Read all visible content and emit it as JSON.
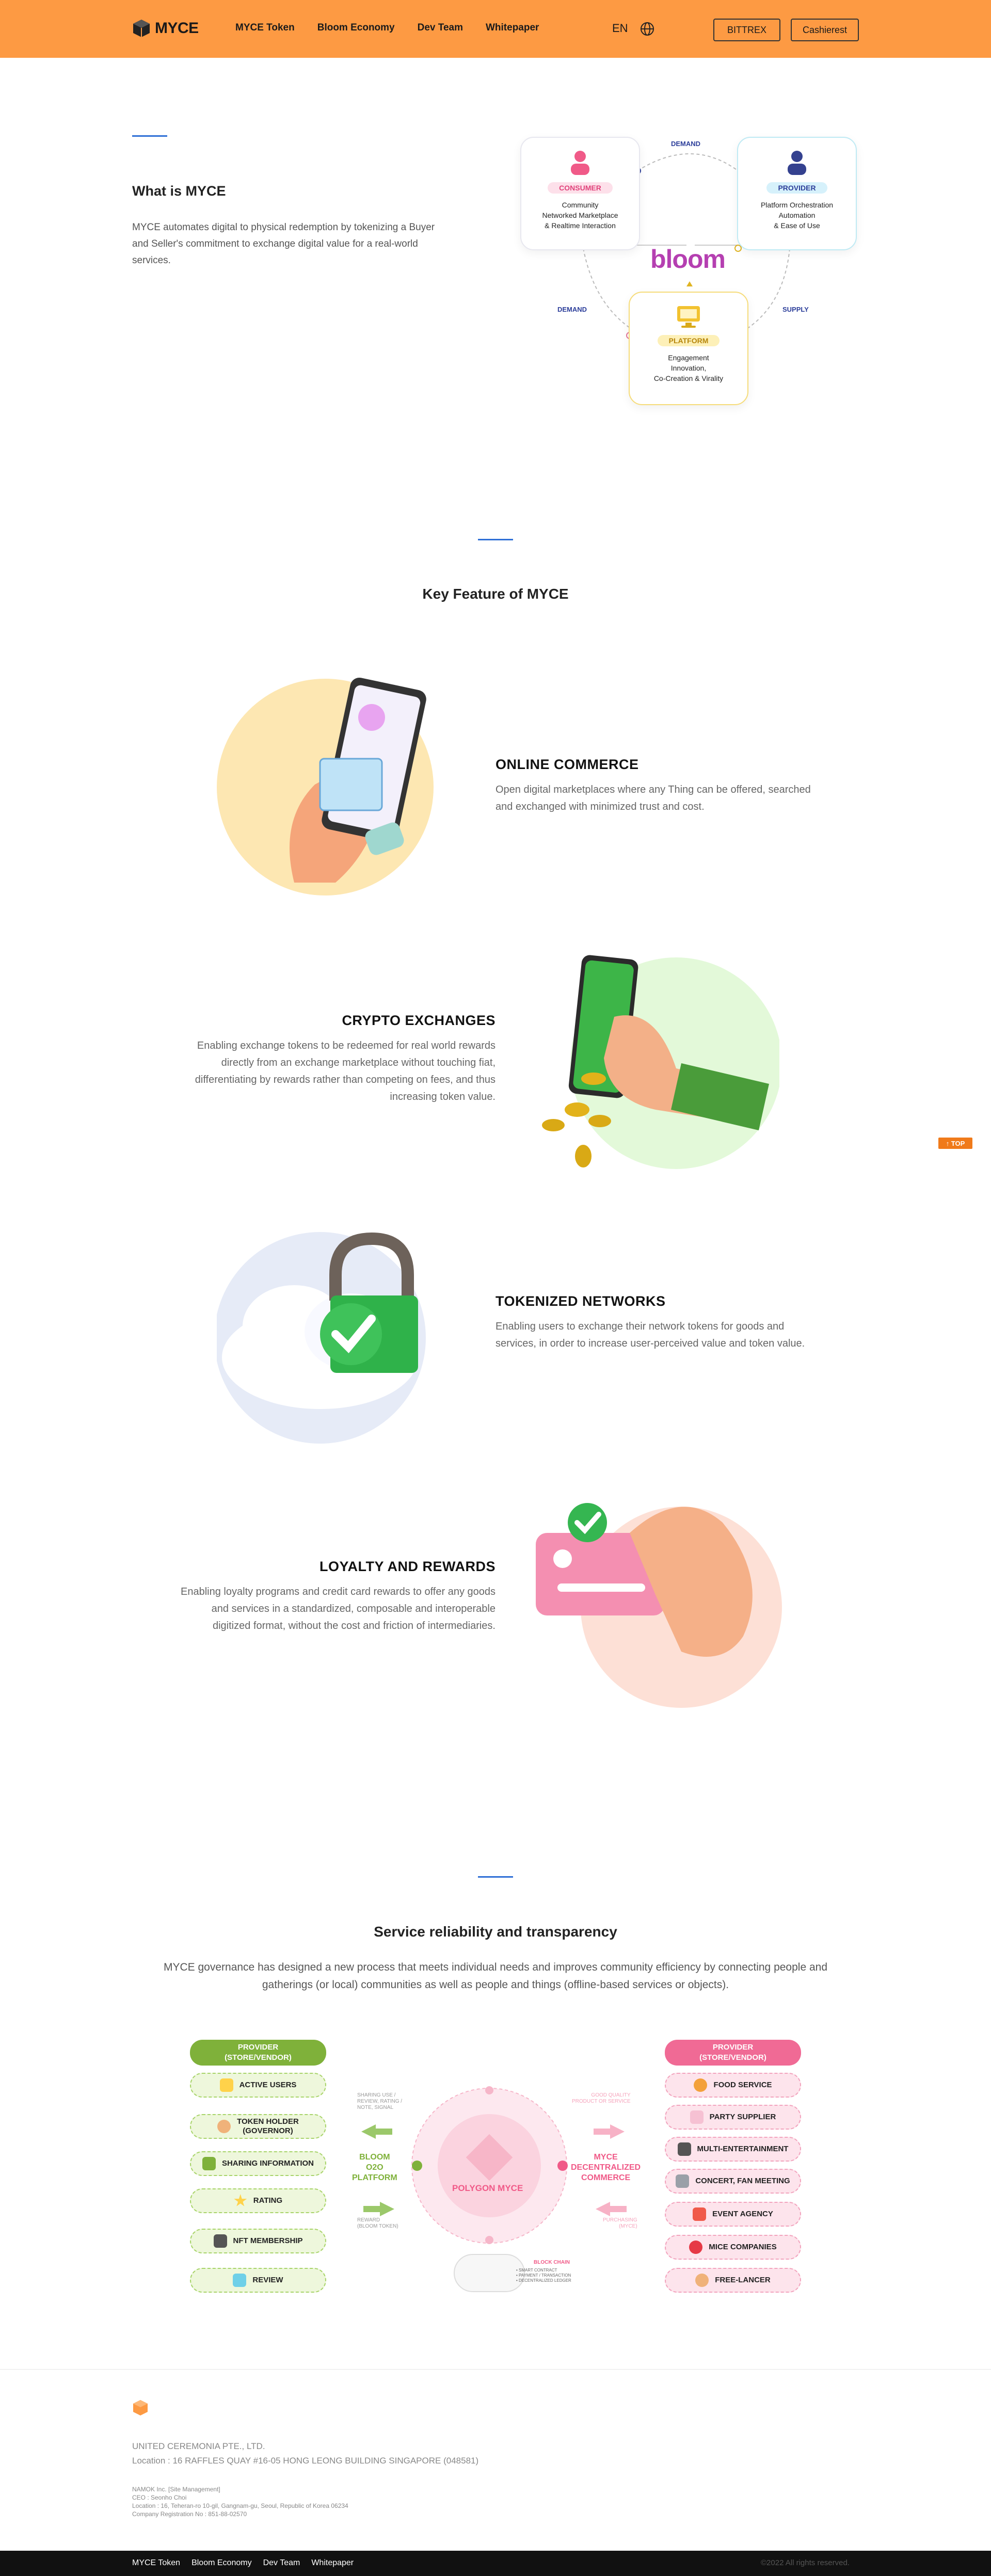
{
  "header": {
    "brand": "MYCE",
    "nav": [
      "MYCE Token",
      "Bloom Economy",
      "Dev Team",
      "Whitepaper"
    ],
    "lang": "EN",
    "buttons": {
      "bittrex": "BITTREX",
      "cashierest": "Cashierest"
    },
    "colors": {
      "background": "#fd9a43"
    }
  },
  "what": {
    "title_prefix": "What is ",
    "title_brand": "MYCE",
    "description": "MYCE automates digital to physical redemption by tokenizing a Buyer and Seller's commitment to exchange digital value for a real-world services."
  },
  "diagram": {
    "consumer": {
      "tag": "CONSUMER",
      "desc": "Community\nNetworked Marketplace\n& Realtime Interaction"
    },
    "provider": {
      "tag": "PROVIDER",
      "desc": "Platform Orchestration\nAutomation\n& Ease of Use"
    },
    "platform": {
      "tag": "PLATFORM",
      "desc": "Engagement\nInnovation,\nCo-Creation & Virality"
    },
    "center_brand": "bloom",
    "edge_top": "DEMAND",
    "edge_left": "DEMAND",
    "edge_right": "SUPPLY"
  },
  "key_feature": {
    "title_bold": "Key Feature",
    "title_rest": " of MYCE",
    "items": [
      {
        "title": "ONLINE COMMERCE",
        "desc": "Open digital marketplaces where any Thing can be offered, searched and exchanged with minimized trust and cost."
      },
      {
        "title": "CRYPTO EXCHANGES",
        "desc": "Enabling exchange tokens to be redeemed for real world rewards directly from an exchange marketplace without touching fiat, differentiating by rewards rather than competing on fees, and thus increasing token value."
      },
      {
        "title": "TOKENIZED NETWORKS",
        "desc": "Enabling users to exchange their network tokens for goods and services, in order to increase user-perceived value and token value."
      },
      {
        "title": "LOYALTY AND REWARDS",
        "desc": "Enabling loyalty programs and credit card rewards to offer any goods and services in a standardized, composable and interoperable digitized format, without the cost and friction of intermediaries."
      }
    ]
  },
  "reliability": {
    "title_bold1": "Service reliability",
    "title_and": " and ",
    "title_bold2": "transparency",
    "description": "MYCE governance has designed a new process that meets individual needs and improves community efficiency by connecting people and gatherings (or local) communities as well as people and things (offline-based services or objects).",
    "left_head": "PROVIDER\n(STORE/VENDOR)",
    "left_items": [
      "ACTIVE USERS",
      "TOKEN HOLDER\n(GOVERNOR)",
      "SHARING INFORMATION",
      "RATING",
      "NFT MEMBERSHIP",
      "REVIEW"
    ],
    "right_head": "PROVIDER\n(STORE/VENDOR)",
    "right_items": [
      "FOOD SERVICE",
      "PARTY SUPPLIER",
      "MULTI-ENTERTAINMENT",
      "CONCERT, FAN MEETING",
      "EVENT AGENCY",
      "MICE COMPANIES",
      "FREE-LANCER"
    ],
    "left_platform": "BLOOM\nO2O\nPLATFORM",
    "right_platform": "MYCE\nDECENTRALIZED\nCOMMERCE",
    "center": "POLYGON MYCE",
    "left_arrow_top": "SHARING USE /\nREVIEW, RATING /\nNOTE, SIGNAL",
    "left_arrow_bottom": "REWARD\n(BLOOM TOKEN)",
    "right_arrow_top": "GOOD QUALITY\nPRODUCT OR SERVICE",
    "right_arrow_bottom": "PURCHASING\n(MYCE)",
    "blockchain_title": "BLOCK CHAIN",
    "blockchain_items": [
      "• SMART CONTRACT",
      "• PAYMENT / TRANSACTION",
      "• DECENTRALIZED LEDGER"
    ]
  },
  "footer": {
    "company": "UNITED CEREMONIA PTE., LTD.",
    "location": "Location : 16 RAFFLES QUAY #16-05 HONG LEONG BUILDING SINGAPORE (048581)",
    "small": [
      "NAMOK Inc. [Site Management]",
      "CEO : Seonho Choi",
      "Location : 16, Teheran-ro 10-gil, Gangnam-gu, Seoul, Republic of Korea 06234",
      "Company Registration No : 851-88-02570"
    ],
    "nav": [
      "MYCE Token",
      "Bloom Economy",
      "Dev Team",
      "Whitepaper"
    ],
    "copyright": "©2022 All rights reserved.",
    "top_button": "↑ TOP"
  }
}
